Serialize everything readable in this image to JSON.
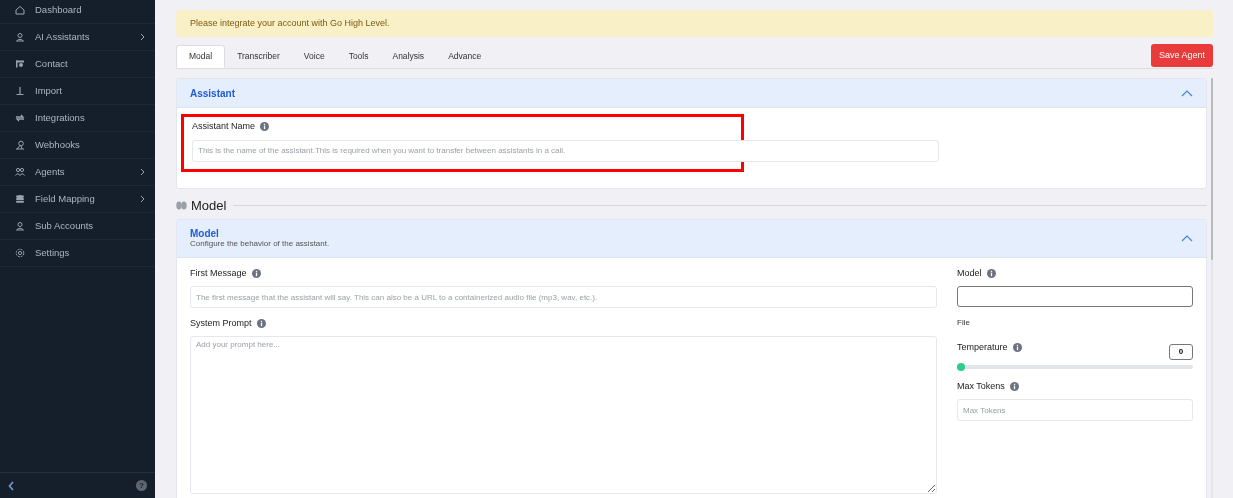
{
  "sidebar": {
    "items": [
      {
        "label": "Dashboard",
        "expandable": false
      },
      {
        "label": "AI Assistants",
        "expandable": true
      },
      {
        "label": "Contact",
        "expandable": false
      },
      {
        "label": "Import",
        "expandable": false
      },
      {
        "label": "Integrations",
        "expandable": false
      },
      {
        "label": "Webhooks",
        "expandable": false
      },
      {
        "label": "Agents",
        "expandable": true
      },
      {
        "label": "Field Mapping",
        "expandable": true
      },
      {
        "label": "Sub Accounts",
        "expandable": false
      },
      {
        "label": "Settings",
        "expandable": false
      }
    ]
  },
  "help_button": "?",
  "alert": "Please integrate your account with Go High Level.",
  "tabs": [
    {
      "label": "Modal",
      "selected": true
    },
    {
      "label": "Transcriber",
      "selected": false
    },
    {
      "label": "Voice",
      "selected": false
    },
    {
      "label": "Tools",
      "selected": false
    },
    {
      "label": "Analysis",
      "selected": false
    },
    {
      "label": "Advance",
      "selected": false
    }
  ],
  "save_button": "Save Agent",
  "assistant_panel": {
    "title": "Assistant",
    "expanded": true,
    "field": {
      "label": "Assistant Name",
      "placeholder": "This is the name of the assistant.This is required when you want to transfer between assistants in a call.",
      "highlighted": true
    }
  },
  "section_heading": "Model",
  "model_panel": {
    "title": "Model",
    "subtitle": "Configure the behavior of the assistant.",
    "expanded": true,
    "first_message": {
      "label": "First Message",
      "placeholder": "The first message that the assistant will say. This can also be a URL to a containerized audio file (mp3, wav, etc.)."
    },
    "system_prompt": {
      "label": "System Prompt",
      "placeholder": "Add your prompt here..."
    },
    "model": {
      "label": "Model"
    },
    "file_label": "File",
    "temperature": {
      "label": "Temperature",
      "reading": "0",
      "level": 0
    },
    "max_tokens": {
      "label": "Max Tokens",
      "placeholder": "Max Tokens"
    }
  }
}
